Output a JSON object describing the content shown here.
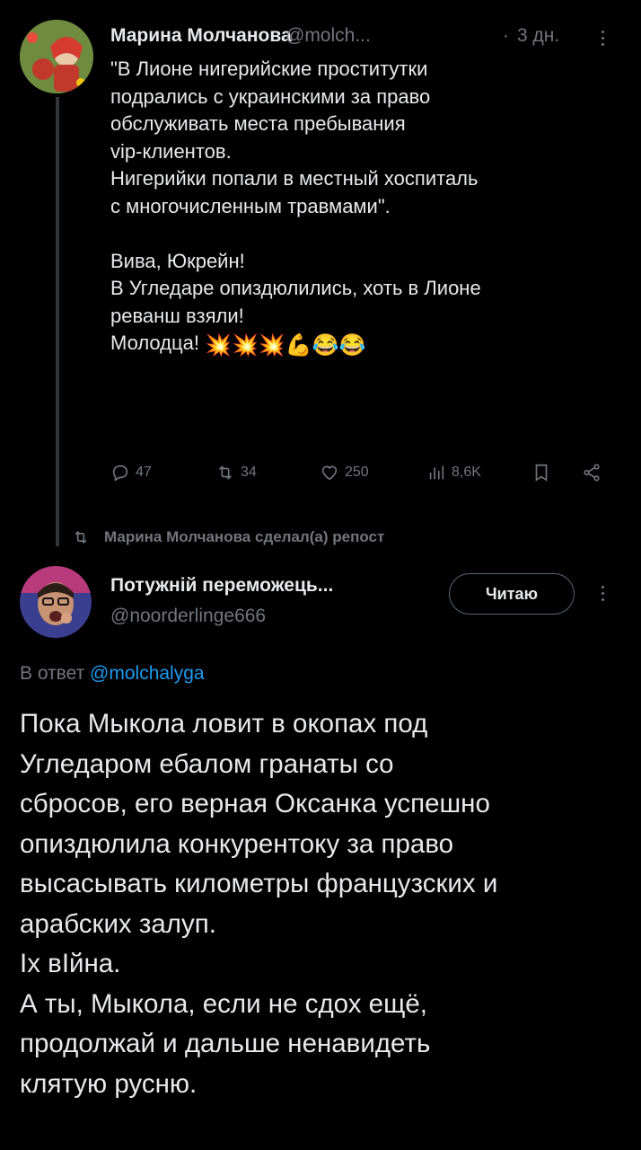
{
  "tweet1": {
    "author_name": "Марина Молчанова",
    "handle": "@molch...",
    "separator": "·",
    "time": "3 дн.",
    "text": "\"В Лионе нигерийские проститутки\nподрались с украинскими за право\nобслуживать места пребывания\nvip-клиентов.\nНигерийки попали в местный хоспиталь\nс многочисленным травмами\".\n\nВива, Юкрейн!\nВ Угледаре опиздюлились, хоть в Лионе\nреванш взяли!\nМолодца! ",
    "emojis": "💥💥💥💪😂😂",
    "stats": {
      "replies": "47",
      "reposts": "34",
      "likes": "250",
      "views": "8,6K"
    }
  },
  "repost_notice": "Марина Молчанова сделал(а) репост",
  "tweet2": {
    "author_name": "Потужній переможець...",
    "handle": "@noorderlinge666",
    "follow_label": "Читаю",
    "reply_prefix": "В ответ",
    "reply_handle": "@molchalyga",
    "text": "Пока Мыкола ловит в окопах под\nУгледаром ебалом гранаты со\nсбросов, его верная Оксанка успешно\nопиздюлила конкурентоку за право\nвысасывать километры французских и\nарабских залуп.\nІх вІйна.\nА ты, Мыкола, если не сдох ещё,\nпродолжай и дальше ненавидеть\nклятую русню."
  },
  "colors": {
    "background": "#000000",
    "text": "#e7e9ea",
    "muted": "#71767b",
    "link": "#1d9bf0",
    "border": "#536471"
  }
}
